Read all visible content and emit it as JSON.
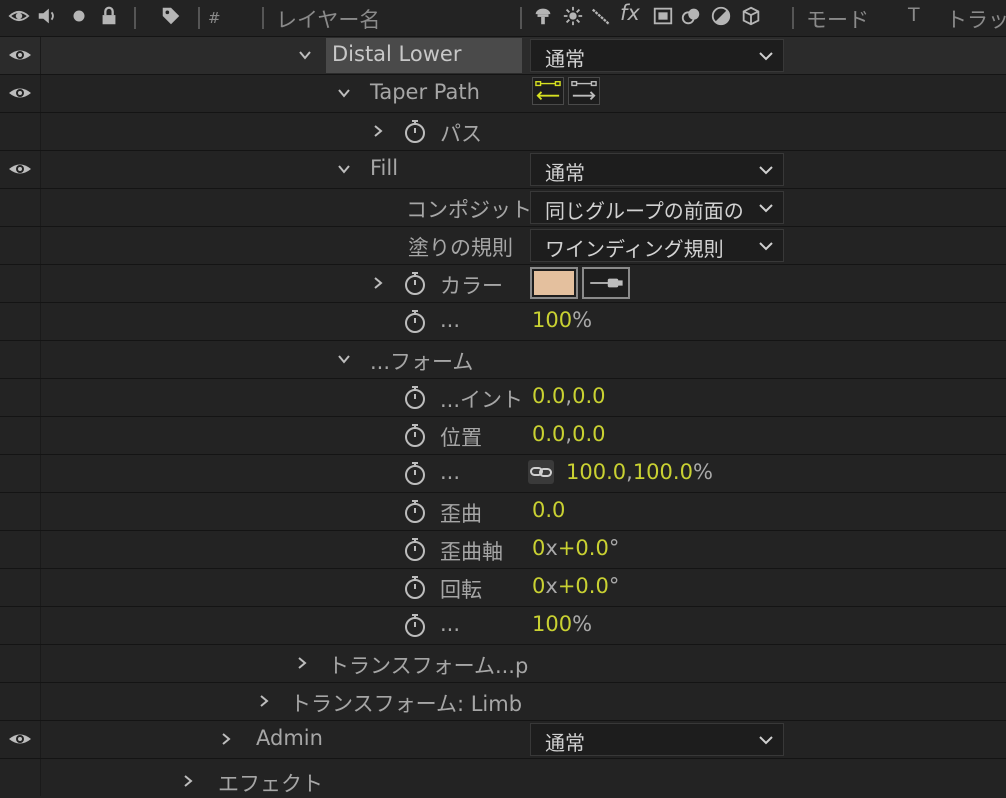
{
  "header": {
    "hash_label": "#",
    "layer_name_label": "レイヤー名",
    "fx_label": "fx",
    "mode_label": "モード",
    "t_label": "T",
    "track_label": "トラッ"
  },
  "colors": {
    "value_yellow": "#c9d132",
    "swatch_color": "#e4c09e",
    "taper_active": "#d6e021"
  },
  "rows": {
    "r1": {
      "label": "Distal Lower",
      "mode": "通常"
    },
    "r2": {
      "label": "Taper Path"
    },
    "r3": {
      "label": "パス"
    },
    "r4": {
      "label": "Fill",
      "mode": "通常"
    },
    "r5": {
      "label": "コンポジット",
      "value": "同じグループの前面の"
    },
    "r6": {
      "label": "塗りの規則",
      "value": "ワインディング規則"
    },
    "r7": {
      "label": "カラー"
    },
    "r8": {
      "label": "...",
      "value": "100",
      "unit": "%"
    },
    "r9": {
      "label": "...フォーム"
    },
    "r10": {
      "label": "...イント",
      "v1": "0.0",
      "sep": ",",
      "v2": "0.0"
    },
    "r11": {
      "label": "位置",
      "v1": "0.0",
      "sep": ",",
      "v2": "0.0"
    },
    "r12": {
      "label": "...",
      "v1": "100.0",
      "sep": ",",
      "v2": "100.0",
      "unit": "%"
    },
    "r13": {
      "label": "歪曲",
      "value": "0.0"
    },
    "r14": {
      "label": "歪曲軸",
      "v1": "0",
      "x": "x",
      "v2": "+0.0",
      "deg": "°"
    },
    "r15": {
      "label": "回転",
      "v1": "0",
      "x": "x",
      "v2": "+0.0",
      "deg": "°"
    },
    "r16": {
      "label": "...",
      "value": "100",
      "unit": "%"
    },
    "r17": {
      "label": "トランスフォーム...p"
    },
    "r18": {
      "label": "トランスフォーム: Limb"
    },
    "r19": {
      "label": "Admin",
      "mode": "通常"
    },
    "r20": {
      "label": "エフェクト"
    }
  }
}
